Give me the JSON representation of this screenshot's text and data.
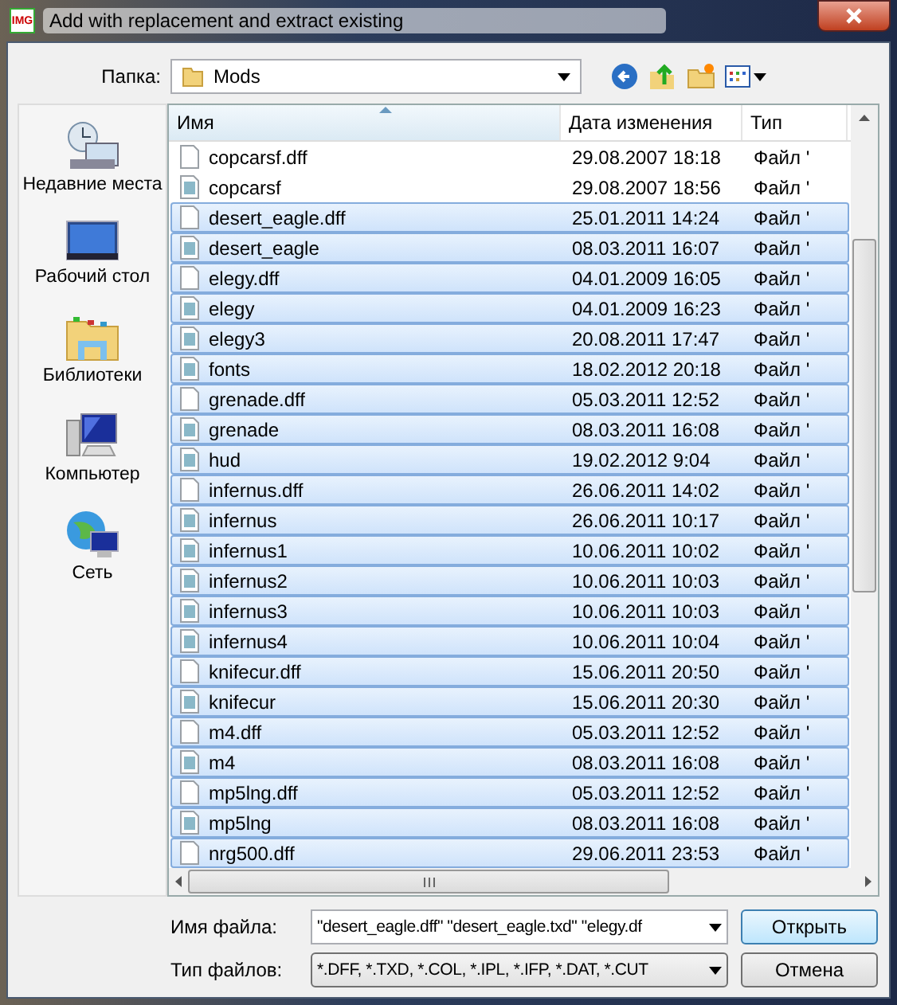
{
  "window": {
    "title": "Add with replacement and extract existing",
    "app_icon": "IMG"
  },
  "location": {
    "label": "Папка:",
    "value": "Mods"
  },
  "sidebar": {
    "items": [
      {
        "label": "Недавние места",
        "kind": "recent"
      },
      {
        "label": "Рабочий стол",
        "kind": "desktop"
      },
      {
        "label": "Библиотеки",
        "kind": "libraries"
      },
      {
        "label": "Компьютер",
        "kind": "computer"
      },
      {
        "label": "Сеть",
        "kind": "network"
      }
    ]
  },
  "table": {
    "columns": [
      "Имя",
      "Дата изменения",
      "Тип"
    ],
    "rows": [
      {
        "name": "copcarsf.dff",
        "date": "29.08.2007 18:18",
        "type": "Файл '",
        "kind": "blank",
        "selected": false
      },
      {
        "name": "copcarsf",
        "date": "29.08.2007 18:56",
        "type": "Файл '",
        "kind": "image",
        "selected": false
      },
      {
        "name": "desert_eagle.dff",
        "date": "25.01.2011 14:24",
        "type": "Файл '",
        "kind": "blank",
        "selected": true
      },
      {
        "name": "desert_eagle",
        "date": "08.03.2011 16:07",
        "type": "Файл '",
        "kind": "image",
        "selected": true
      },
      {
        "name": "elegy.dff",
        "date": "04.01.2009 16:05",
        "type": "Файл '",
        "kind": "blank",
        "selected": true
      },
      {
        "name": "elegy",
        "date": "04.01.2009 16:23",
        "type": "Файл '",
        "kind": "image",
        "selected": true
      },
      {
        "name": "elegy3",
        "date": "20.08.2011 17:47",
        "type": "Файл '",
        "kind": "image",
        "selected": true
      },
      {
        "name": "fonts",
        "date": "18.02.2012 20:18",
        "type": "Файл '",
        "kind": "image",
        "selected": true
      },
      {
        "name": "grenade.dff",
        "date": "05.03.2011 12:52",
        "type": "Файл '",
        "kind": "blank",
        "selected": true
      },
      {
        "name": "grenade",
        "date": "08.03.2011 16:08",
        "type": "Файл '",
        "kind": "image",
        "selected": true
      },
      {
        "name": "hud",
        "date": "19.02.2012 9:04",
        "type": "Файл '",
        "kind": "image",
        "selected": true
      },
      {
        "name": "infernus.dff",
        "date": "26.06.2011 14:02",
        "type": "Файл '",
        "kind": "blank",
        "selected": true
      },
      {
        "name": "infernus",
        "date": "26.06.2011 10:17",
        "type": "Файл '",
        "kind": "image",
        "selected": true
      },
      {
        "name": "infernus1",
        "date": "10.06.2011 10:02",
        "type": "Файл '",
        "kind": "image",
        "selected": true
      },
      {
        "name": "infernus2",
        "date": "10.06.2011 10:03",
        "type": "Файл '",
        "kind": "image",
        "selected": true
      },
      {
        "name": "infernus3",
        "date": "10.06.2011 10:03",
        "type": "Файл '",
        "kind": "image",
        "selected": true
      },
      {
        "name": "infernus4",
        "date": "10.06.2011 10:04",
        "type": "Файл '",
        "kind": "image",
        "selected": true
      },
      {
        "name": "knifecur.dff",
        "date": "15.06.2011 20:50",
        "type": "Файл '",
        "kind": "blank",
        "selected": true
      },
      {
        "name": "knifecur",
        "date": "15.06.2011 20:30",
        "type": "Файл '",
        "kind": "image",
        "selected": true
      },
      {
        "name": "m4.dff",
        "date": "05.03.2011 12:52",
        "type": "Файл '",
        "kind": "blank",
        "selected": true
      },
      {
        "name": "m4",
        "date": "08.03.2011 16:08",
        "type": "Файл '",
        "kind": "image",
        "selected": true
      },
      {
        "name": "mp5lng.dff",
        "date": "05.03.2011 12:52",
        "type": "Файл '",
        "kind": "blank",
        "selected": true
      },
      {
        "name": "mp5lng",
        "date": "08.03.2011 16:08",
        "type": "Файл '",
        "kind": "image",
        "selected": true
      },
      {
        "name": "nrg500.dff",
        "date": "29.06.2011 23:53",
        "type": "Файл '",
        "kind": "blank",
        "selected": true
      }
    ]
  },
  "filename": {
    "label": "Имя файла:",
    "value": "\"desert_eagle.dff\" \"desert_eagle.txd\" \"elegy.df"
  },
  "filetype": {
    "label": "Тип файлов:",
    "value": "*.DFF, *.TXD, *.COL, *.IPL, *.IFP, *.DAT, *.CUT"
  },
  "buttons": [
    "Открыть",
    "Отмена"
  ]
}
